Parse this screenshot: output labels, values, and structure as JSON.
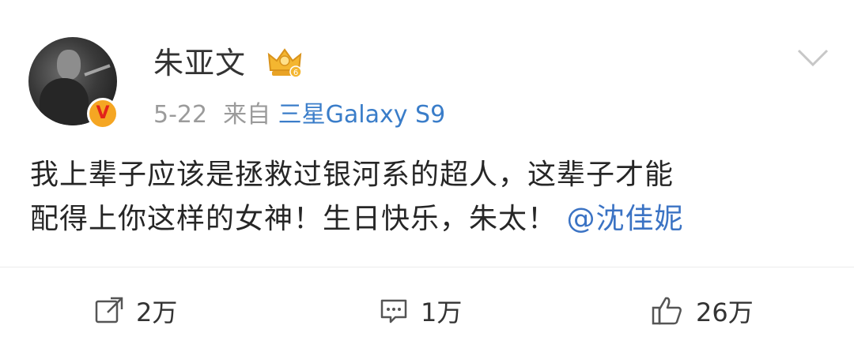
{
  "user": {
    "name": "朱亚文"
  },
  "meta": {
    "date": "5-22",
    "source_prefix": "来自",
    "device": "三星Galaxy S9"
  },
  "post": {
    "line1": "我上辈子应该是拯救过银河系的超人，这辈子才能",
    "line2": "配得上你这样的女神！生日快乐，朱太！",
    "mention": "@沈佳妮"
  },
  "actions": {
    "repost_count": "2万",
    "comment_count": "1万",
    "like_count": "26万"
  },
  "icons": {
    "verify": "verified-v-icon",
    "crown": "crown-icon",
    "chevron": "chevron-down-icon",
    "repost": "share-icon",
    "comment": "comment-icon",
    "like": "thumbs-up-icon"
  },
  "colors": {
    "link": "#3b73c4",
    "meta": "#9b9b9b",
    "badge": "#f5a623"
  }
}
